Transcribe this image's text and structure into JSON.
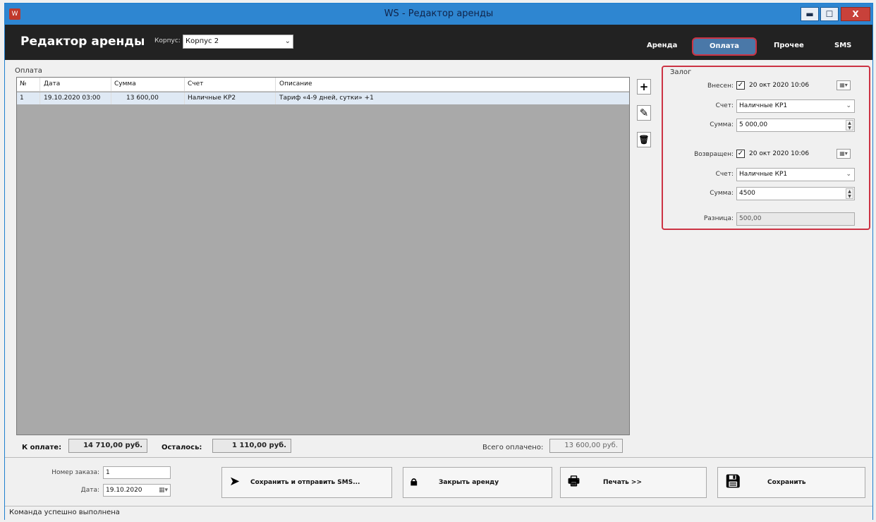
{
  "window": {
    "title": "WS - Редактор аренды",
    "app_icon": "app-icon",
    "min": "▬",
    "max": "☐",
    "close": "X"
  },
  "header": {
    "title": "Редактор аренды",
    "corpus_label": "Корпус:",
    "corpus_value": "Корпус 2",
    "tabs": [
      {
        "label": "Аренда",
        "active": false
      },
      {
        "label": "Оплата",
        "active": true
      },
      {
        "label": "Прочее",
        "active": false
      },
      {
        "label": "SMS",
        "active": false
      }
    ]
  },
  "payment": {
    "group_label": "Оплата",
    "columns": [
      "№",
      "Дата",
      "Сумма",
      "Счет",
      "Описание"
    ],
    "rows": [
      {
        "num": "1",
        "date": "19.10.2020 03:00",
        "sum": "13 600,00",
        "account": "Наличные КР2",
        "description": "Тариф «4-9 дней, сутки» +1"
      }
    ],
    "tools": {
      "add": "+",
      "edit": "✎",
      "delete": "🗑"
    }
  },
  "summary": {
    "to_pay_label": "К оплате:",
    "to_pay_value": "14 710,00 руб.",
    "remaining_label": "Осталось:",
    "remaining_value": "1 110,00 руб.",
    "total_paid_label": "Всего оплачено:",
    "total_paid_value": "13 600,00 руб."
  },
  "deposit": {
    "group_label": "Залог",
    "deposited_label": "Внесен:",
    "deposited_checked": true,
    "deposited_date": "20 окт 2020  10:06",
    "account_label": "Счет:",
    "deposited_account": "Наличные КР1",
    "sum_label": "Сумма:",
    "deposited_sum": "5 000,00",
    "returned_label": "Возвращен:",
    "returned_checked": true,
    "returned_date": "20 окт 2020  10:06",
    "returned_account": "Наличные КР1",
    "returned_sum": "4500",
    "difference_label": "Разница:",
    "difference_value": "500,00"
  },
  "footer": {
    "order_number_label": "Номер заказа:",
    "order_number_value": "1",
    "date_label": "Дата:",
    "date_value": "19.10.2020",
    "buttons": {
      "save_send": "Сохранить и отправить SMS...",
      "close_rent": "Закрыть аренду",
      "print": "Печать  >>",
      "save": "Сохранить"
    }
  },
  "status": {
    "text": "Команда успешно выполнена"
  },
  "colors": {
    "title_bar": "#2e86d1",
    "header_bg": "#222222",
    "highlight": "#cc3344",
    "grid_bg": "#a9a9a9",
    "selected_row": "#dfe9f4"
  }
}
